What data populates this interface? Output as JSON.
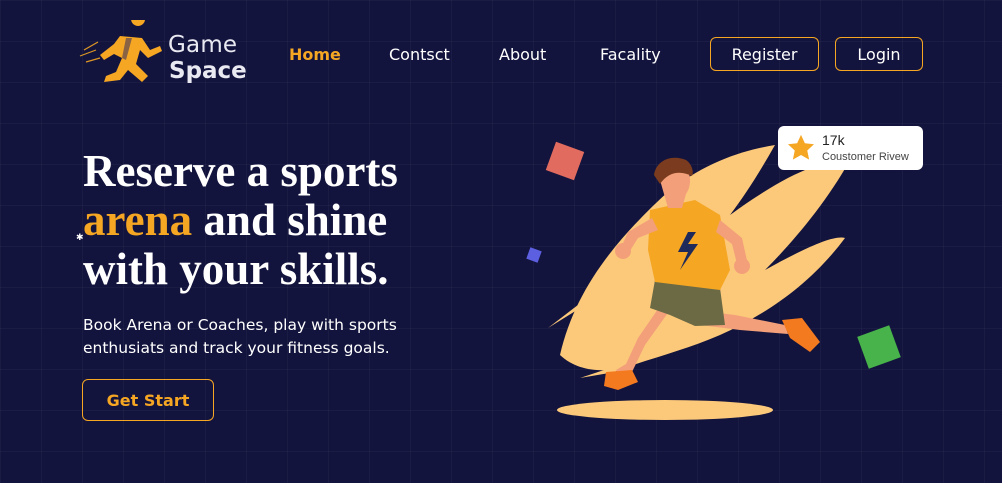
{
  "brand": {
    "line1": "Game",
    "line2": "Space"
  },
  "nav": {
    "items": [
      {
        "label": "Home",
        "active": true
      },
      {
        "label": "Contsct",
        "active": false
      },
      {
        "label": "About",
        "active": false
      },
      {
        "label": "Facality",
        "active": false
      }
    ],
    "register_label": "Register",
    "login_label": "Login"
  },
  "hero": {
    "headline_part1": "Reserve a sports",
    "headline_accent": "arena",
    "headline_part2": "and shine",
    "headline_part3": "with your skills.",
    "subtext": "Book Arena or Coaches, play with sports enthusiats and track your fitness goals.",
    "cta_label": "Get Start"
  },
  "review": {
    "count": "17k",
    "label": "Coustomer Rivew",
    "icon": "star-icon"
  },
  "colors": {
    "background": "#13143d",
    "accent": "#f5a623",
    "text": "#ffffff"
  }
}
